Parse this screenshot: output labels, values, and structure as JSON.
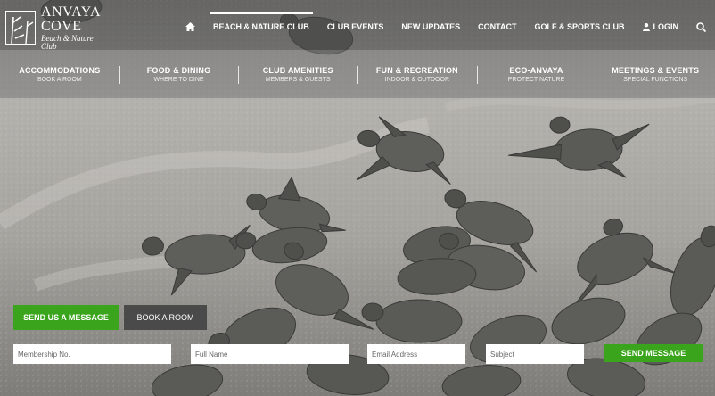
{
  "brand": {
    "name_line1": "ANVAYA",
    "name_line2": "COVE",
    "tagline": "Beach & Nature Club"
  },
  "top_nav": {
    "items": [
      {
        "label": "BEACH & NATURE CLUB",
        "active": true
      },
      {
        "label": "CLUB EVENTS"
      },
      {
        "label": "NEW UPDATES"
      },
      {
        "label": "CONTACT"
      },
      {
        "label": "GOLF & SPORTS CLUB"
      }
    ],
    "login_label": "LOGIN",
    "home_icon": "home-icon",
    "search_icon": "search-icon"
  },
  "sub_nav": {
    "items": [
      {
        "title": "ACCOMMODATIONS",
        "subtitle": "BOOK A ROOM"
      },
      {
        "title": "FOOD & DINING",
        "subtitle": "WHERE TO DINE"
      },
      {
        "title": "CLUB AMENITIES",
        "subtitle": "MEMBERS & GUESTS"
      },
      {
        "title": "FUN & RECREATION",
        "subtitle": "INDOOR & OUTDOOR"
      },
      {
        "title": "ECO-ANVAYA",
        "subtitle": "PROTECT NATURE"
      },
      {
        "title": "MEETINGS & EVENTS",
        "subtitle": "SPECIAL FUNCTIONS"
      }
    ]
  },
  "actions": {
    "send_us_label": "SEND US A MESSAGE",
    "book_label": "BOOK A ROOM"
  },
  "form": {
    "membership_placeholder": "Membership No.",
    "name_placeholder": "Full Name",
    "email_placeholder": "Email Address",
    "subject_placeholder": "Subject",
    "submit_label": "SEND MESSAGE"
  },
  "colors": {
    "accent_green": "#3aa51c",
    "dark_button": "#4a4a4a",
    "sand": "#a9a7a2"
  }
}
